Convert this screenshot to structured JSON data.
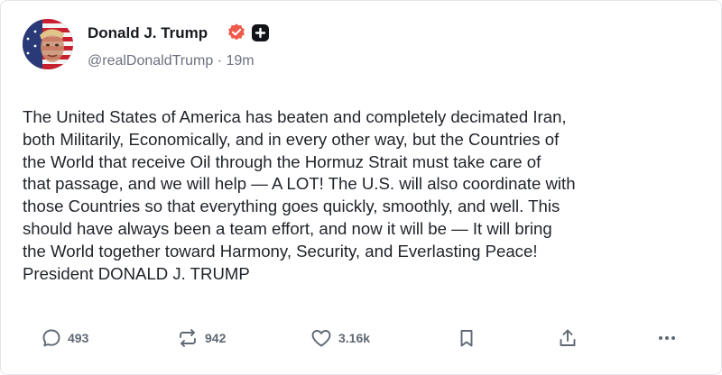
{
  "author": {
    "name": "Donald J. Trump",
    "handle": "@realDonaldTrump",
    "separator": "·",
    "time": "19m"
  },
  "post": {
    "lines": [
      "The United States of America has beaten and completely decimated Iran,",
      "both Militarily, Economically, and in every other way, but the Countries of",
      "the World that receive Oil through the Hormuz Strait must take care of",
      "that passage, and we will help — A LOT! The U.S. will also coordinate with",
      "those Countries so that everything goes quickly, smoothly, and well. This",
      "should have always been a team effort, and now it will be — It will bring",
      "the World together toward Harmony, Security, and Everlasting Peace!",
      "President DONALD J. TRUMP"
    ]
  },
  "actions": {
    "replies": "493",
    "reposts": "942",
    "likes": "3.16k"
  },
  "icons": {
    "verified": "verified-badge-icon",
    "follow": "plus-icon",
    "reply": "comment-bubble-icon",
    "repost": "repost-arrows-icon",
    "like": "heart-icon",
    "bookmark": "bookmark-icon",
    "share": "share-upload-icon",
    "more": "more-dots-icon"
  },
  "colors": {
    "verified_badge": "#ee5a4b",
    "text": "#1f2329",
    "muted": "#6b7280",
    "icon": "#5f6873"
  }
}
